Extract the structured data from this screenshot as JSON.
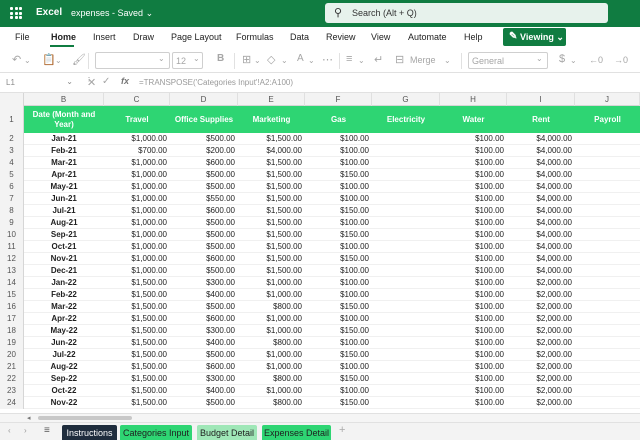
{
  "titlebar": {
    "app_name": "Excel",
    "doc_name": "expenses",
    "save_state": "Saved",
    "search_placeholder": "Search (Alt + Q)"
  },
  "ribbon_tabs": [
    "File",
    "Home",
    "Insert",
    "Draw",
    "Page Layout",
    "Formulas",
    "Data",
    "Review",
    "View",
    "Automate",
    "Help"
  ],
  "active_tab": "Home",
  "mode_button": "Viewing",
  "toolbar": {
    "font_size": "12",
    "merge_label": "Merge",
    "number_format": "General",
    "currency_symbol": "$"
  },
  "formula_bar": {
    "cell_ref": "L1",
    "formula": "=TRANSPOSE('Categories Input'!A2:A100)"
  },
  "grid": {
    "col_letters": [
      "B",
      "C",
      "D",
      "E",
      "F",
      "G",
      "H",
      "I",
      "J"
    ],
    "headers": [
      "Date (Month and Year)",
      "Travel",
      "Office Supplies",
      "Marketing",
      "Gas",
      "Electricity",
      "Water",
      "Rent",
      "Payroll"
    ],
    "header_color": "#2ed573",
    "row_numbers": [
      "1",
      "2",
      "3",
      "4",
      "5",
      "6",
      "7",
      "8",
      "9",
      "10",
      "11",
      "12",
      "13",
      "14",
      "15",
      "16",
      "17",
      "18",
      "19",
      "20",
      "21",
      "22",
      "23",
      "24"
    ],
    "rows": [
      [
        "Jan-21",
        "$1,000.00",
        "$500.00",
        "$1,500.00",
        "$100.00",
        "",
        "$100.00",
        "$4,000.00",
        ""
      ],
      [
        "Feb-21",
        "$700.00",
        "$200.00",
        "$4,000.00",
        "$100.00",
        "",
        "$100.00",
        "$4,000.00",
        ""
      ],
      [
        "Mar-21",
        "$1,000.00",
        "$600.00",
        "$1,500.00",
        "$100.00",
        "",
        "$100.00",
        "$4,000.00",
        ""
      ],
      [
        "Apr-21",
        "$1,000.00",
        "$500.00",
        "$1,500.00",
        "$150.00",
        "",
        "$100.00",
        "$4,000.00",
        ""
      ],
      [
        "May-21",
        "$1,000.00",
        "$500.00",
        "$1,500.00",
        "$100.00",
        "",
        "$100.00",
        "$4,000.00",
        ""
      ],
      [
        "Jun-21",
        "$1,000.00",
        "$550.00",
        "$1,500.00",
        "$100.00",
        "",
        "$100.00",
        "$4,000.00",
        ""
      ],
      [
        "Jul-21",
        "$1,000.00",
        "$600.00",
        "$1,500.00",
        "$150.00",
        "",
        "$100.00",
        "$4,000.00",
        ""
      ],
      [
        "Aug-21",
        "$1,000.00",
        "$500.00",
        "$1,500.00",
        "$100.00",
        "",
        "$100.00",
        "$4,000.00",
        ""
      ],
      [
        "Sep-21",
        "$1,000.00",
        "$500.00",
        "$1,500.00",
        "$150.00",
        "",
        "$100.00",
        "$4,000.00",
        ""
      ],
      [
        "Oct-21",
        "$1,000.00",
        "$500.00",
        "$1,500.00",
        "$100.00",
        "",
        "$100.00",
        "$4,000.00",
        ""
      ],
      [
        "Nov-21",
        "$1,000.00",
        "$600.00",
        "$1,500.00",
        "$150.00",
        "",
        "$100.00",
        "$4,000.00",
        ""
      ],
      [
        "Dec-21",
        "$1,000.00",
        "$500.00",
        "$1,500.00",
        "$100.00",
        "",
        "$100.00",
        "$4,000.00",
        ""
      ],
      [
        "Jan-22",
        "$1,500.00",
        "$300.00",
        "$1,000.00",
        "$100.00",
        "",
        "$100.00",
        "$2,000.00",
        ""
      ],
      [
        "Feb-22",
        "$1,500.00",
        "$400.00",
        "$1,000.00",
        "$100.00",
        "",
        "$100.00",
        "$2,000.00",
        ""
      ],
      [
        "Mar-22",
        "$1,500.00",
        "$500.00",
        "$800.00",
        "$150.00",
        "",
        "$100.00",
        "$2,000.00",
        ""
      ],
      [
        "Apr-22",
        "$1,500.00",
        "$600.00",
        "$1,000.00",
        "$100.00",
        "",
        "$100.00",
        "$2,000.00",
        ""
      ],
      [
        "May-22",
        "$1,500.00",
        "$300.00",
        "$1,000.00",
        "$150.00",
        "",
        "$100.00",
        "$2,000.00",
        ""
      ],
      [
        "Jun-22",
        "$1,500.00",
        "$400.00",
        "$800.00",
        "$100.00",
        "",
        "$100.00",
        "$2,000.00",
        ""
      ],
      [
        "Jul-22",
        "$1,500.00",
        "$500.00",
        "$1,000.00",
        "$150.00",
        "",
        "$100.00",
        "$2,000.00",
        ""
      ],
      [
        "Aug-22",
        "$1,500.00",
        "$600.00",
        "$1,000.00",
        "$100.00",
        "",
        "$100.00",
        "$2,000.00",
        ""
      ],
      [
        "Sep-22",
        "$1,500.00",
        "$300.00",
        "$800.00",
        "$150.00",
        "",
        "$100.00",
        "$2,000.00",
        ""
      ],
      [
        "Oct-22",
        "$1,500.00",
        "$400.00",
        "$1,000.00",
        "$100.00",
        "",
        "$100.00",
        "$2,000.00",
        ""
      ],
      [
        "Nov-22",
        "$1,500.00",
        "$500.00",
        "$800.00",
        "$150.00",
        "",
        "$100.00",
        "$2,000.00",
        ""
      ]
    ]
  },
  "sheet_tabs": [
    {
      "label": "Instructions",
      "bg": "#1f2d3d",
      "fg": "#ffffff"
    },
    {
      "label": "Categories Input",
      "bg": "#2ed573",
      "fg": "#1f1f1f"
    },
    {
      "label": "Budget Detail",
      "bg": "#9fe7b7",
      "fg": "#1f1f1f"
    },
    {
      "label": "Expenses Detail",
      "bg": "#2ed573",
      "fg": "#1f1f1f"
    }
  ],
  "active_sheet": "Budget Detail"
}
